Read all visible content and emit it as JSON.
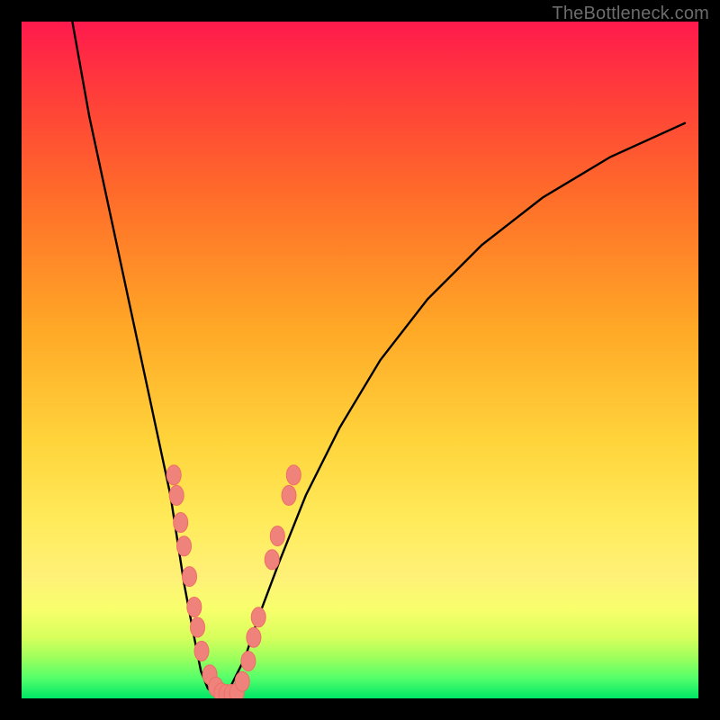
{
  "watermark": "TheBottleneck.com",
  "colors": {
    "curve": "#000000",
    "cluster_fill": "#f0827c",
    "cluster_stroke": "#ee6e67",
    "gradient_top": "#ff1a4d",
    "gradient_bottom": "#00e668",
    "frame": "#000000"
  },
  "chart_data": {
    "type": "line",
    "title": "",
    "xlabel": "",
    "ylabel": "",
    "xlim": [
      0,
      100
    ],
    "ylim": [
      0,
      100
    ],
    "background": "vertical rainbow gradient: red→orange→yellow→green (top→bottom)",
    "annotations": [
      {
        "text": "TheBottleneck.com",
        "position": "top-right"
      }
    ],
    "series": [
      {
        "name": "bottleneck-curve",
        "comment": "V-shaped curve; x in 0..100 maps left→right across plot, y in 0..100 maps bottom→top. Values estimated from grid-free image.",
        "x": [
          7.5,
          10,
          13,
          16,
          19,
          22,
          24,
          25.5,
          26.5,
          27.5,
          28.5,
          29,
          29.5,
          30,
          31,
          33,
          35,
          38,
          42,
          47,
          53,
          60,
          68,
          77,
          87,
          98
        ],
        "y": [
          100,
          86,
          72,
          58,
          44,
          30,
          17,
          9,
          4,
          1.5,
          0.5,
          0.3,
          0.4,
          0.7,
          2,
          6,
          12,
          20,
          30,
          40,
          50,
          59,
          67,
          74,
          80,
          85
        ]
      }
    ],
    "clusters": [
      {
        "name": "left-branch-markers",
        "comment": "salmon-colored oval markers along the descending left branch; values as (x,y) in same 0..100 space",
        "points": [
          [
            22.5,
            33
          ],
          [
            22.9,
            30
          ],
          [
            23.5,
            26
          ],
          [
            24,
            22.5
          ],
          [
            24.8,
            18
          ],
          [
            25.5,
            13.5
          ],
          [
            26,
            10.5
          ],
          [
            26.6,
            7
          ],
          [
            27.8,
            3.5
          ],
          [
            28.7,
            1.7
          ],
          [
            29.5,
            0.8
          ],
          [
            30.2,
            0.6
          ],
          [
            31,
            0.6
          ],
          [
            31.8,
            0.8
          ]
        ]
      },
      {
        "name": "right-branch-markers",
        "points": [
          [
            32.6,
            2.5
          ],
          [
            33.5,
            5.5
          ],
          [
            34.3,
            9
          ],
          [
            35,
            12
          ],
          [
            37,
            20.5
          ],
          [
            37.8,
            24
          ],
          [
            39.5,
            30
          ],
          [
            40.2,
            33
          ]
        ]
      }
    ]
  }
}
